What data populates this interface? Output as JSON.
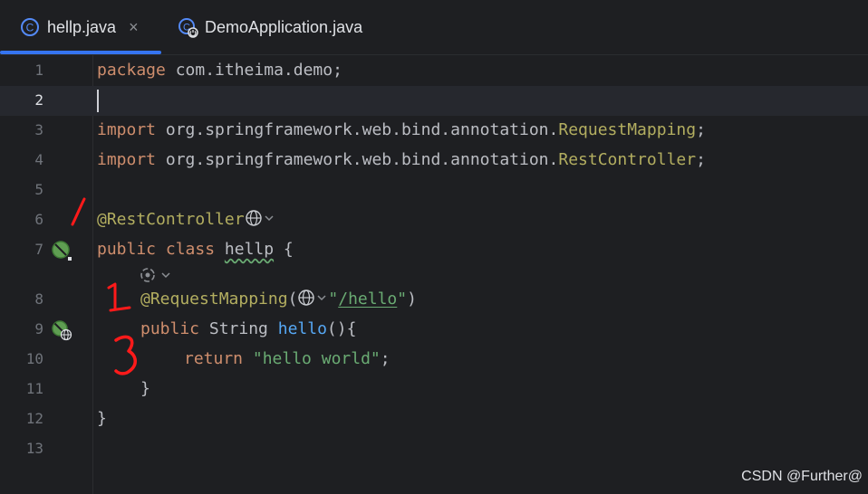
{
  "tabs": [
    {
      "label": "hellp.java",
      "active": true,
      "close": "×"
    },
    {
      "label": "DemoApplication.java",
      "active": false
    }
  ],
  "editor": {
    "line_numbers": [
      "1",
      "2",
      "3",
      "4",
      "5",
      "6",
      "7",
      "",
      "8",
      "9",
      "10",
      "11",
      "12",
      "13"
    ],
    "lines": {
      "l1_kw": "package",
      "l1_rest": " com.itheima.demo;",
      "l3_kw": "import",
      "l3_pkg": " org.springframework.web.bind.annotation.",
      "l3_cls": "RequestMapping",
      "l3_end": ";",
      "l4_kw": "import",
      "l4_pkg": " org.springframework.web.bind.annotation.",
      "l4_cls": "RestController",
      "l4_end": ";",
      "l6_ann": "@RestController",
      "l7_kw": "public class",
      "l7_name": "hellp",
      "l7_end": " {",
      "l8_ann": "@RequestMapping",
      "l8_open": "(",
      "l8_str_q1": "\"",
      "l8_str": "/hello",
      "l8_str_q2": "\"",
      "l8_close": ")",
      "l9_kw": "public",
      "l9_type": " String ",
      "l9_fn": "hello",
      "l9_end": "(){",
      "l10_kw": "return",
      "l10_str": " \"hello world\"",
      "l10_end": ";",
      "l11": "}",
      "l12": "}"
    }
  },
  "colors": {
    "keyword": "#cf8e6d",
    "annotation": "#b3ae60",
    "string": "#6aab73",
    "function": "#56a8f5",
    "accent": "#3574f0"
  },
  "watermark": "CSDN @Further@"
}
